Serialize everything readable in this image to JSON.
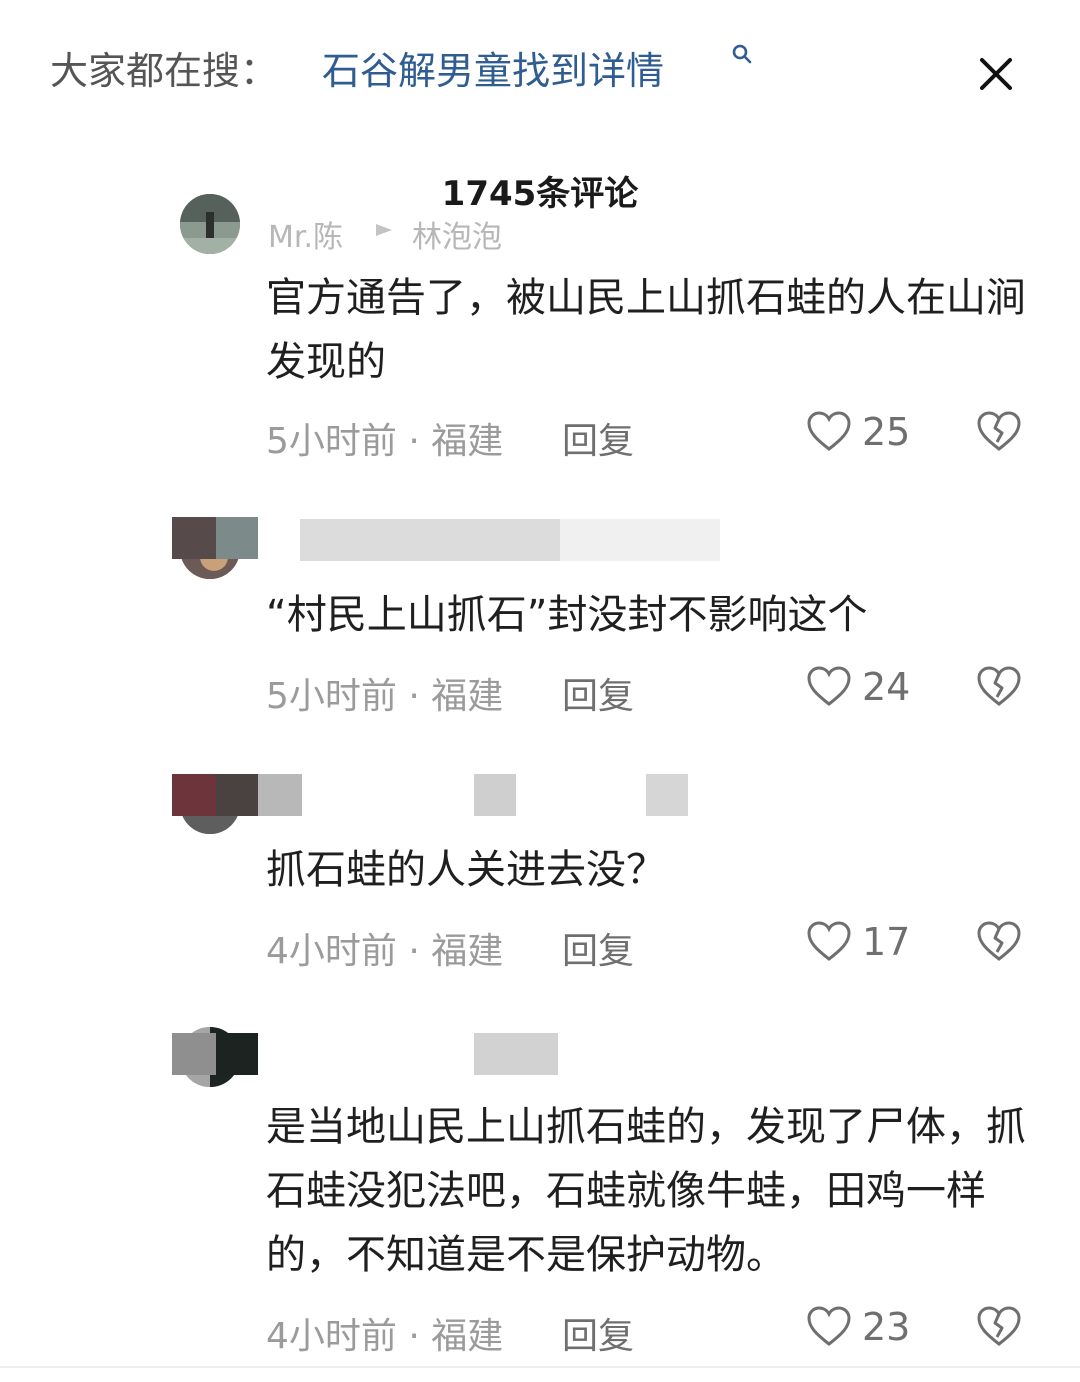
{
  "search": {
    "prefix": "大家都在搜：",
    "link_text": "石谷解男童找到详情",
    "link_color": "#2f5d91",
    "icon": "search-icon"
  },
  "close_icon": "close-icon",
  "comments_header": {
    "title": "1745条评论"
  },
  "comments": [
    {
      "user": "Mr.陈",
      "reply_to": "林泡泡",
      "text": "官方通告了，被山民上山抓石蛙的人在山涧发现的",
      "time": "5小时前 · 福建",
      "reply_label": "回复",
      "likes": "25"
    },
    {
      "user": "",
      "reply_to": "",
      "text": "“村民上山抓石”封没封不影响这个",
      "time": "5小时前 · 福建",
      "reply_label": "回复",
      "likes": "24"
    },
    {
      "user": "",
      "reply_to": "",
      "text": "抓石蛙的人关进去没？",
      "time": "4小时前 · 福建",
      "reply_label": "回复",
      "likes": "17"
    },
    {
      "user": "",
      "reply_to": "",
      "text": "是当地山民上山抓石蛙的，发现了尸体，抓石蛙没犯法吧，石蛙就像牛蛙，田鸡一样的，不知道是不是保护动物。",
      "time": "4小时前 · 福建",
      "reply_label": "回复",
      "likes": "23"
    }
  ]
}
